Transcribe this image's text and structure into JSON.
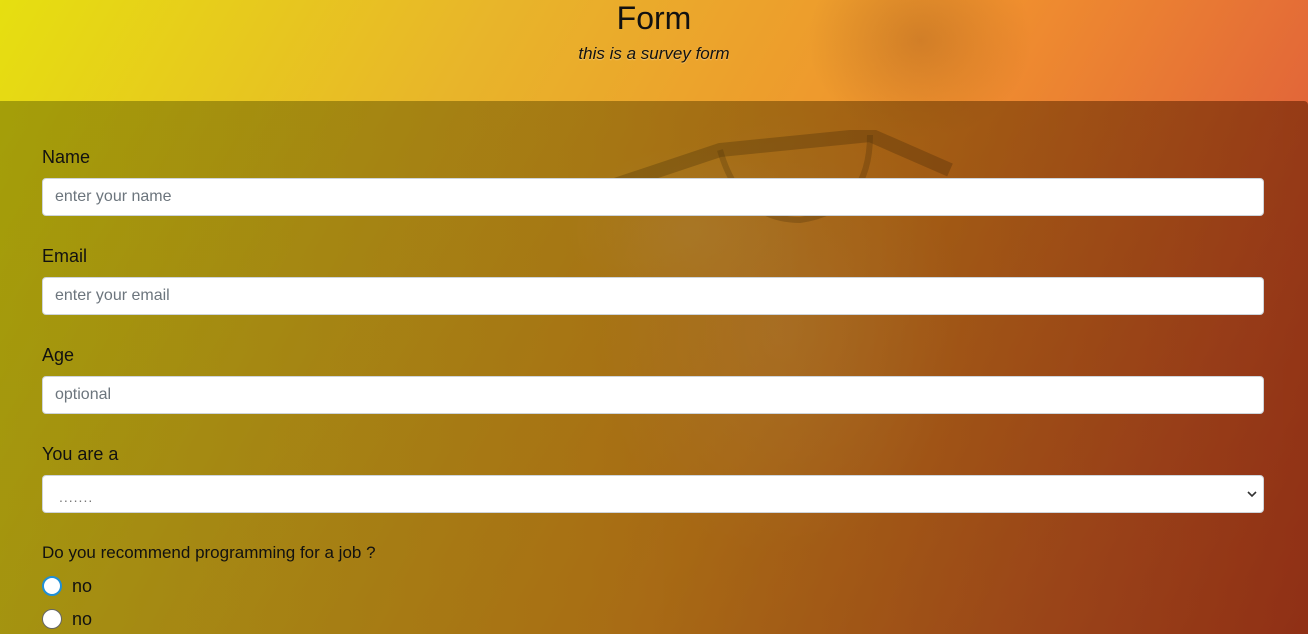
{
  "header": {
    "title": "Form",
    "subtitle": "this is a survey form"
  },
  "form": {
    "name": {
      "label": "Name",
      "placeholder": "enter your name"
    },
    "email": {
      "label": "Email",
      "placeholder": "enter your email"
    },
    "age": {
      "label": "Age",
      "placeholder": "optional"
    },
    "role": {
      "label": "You are a",
      "selected": "......."
    },
    "recommend": {
      "question": "Do you recommend programming for a job ?",
      "options": [
        {
          "label": "no"
        },
        {
          "label": "no"
        }
      ]
    }
  },
  "icons": {
    "select_arrow": "chevron-down-icon"
  }
}
